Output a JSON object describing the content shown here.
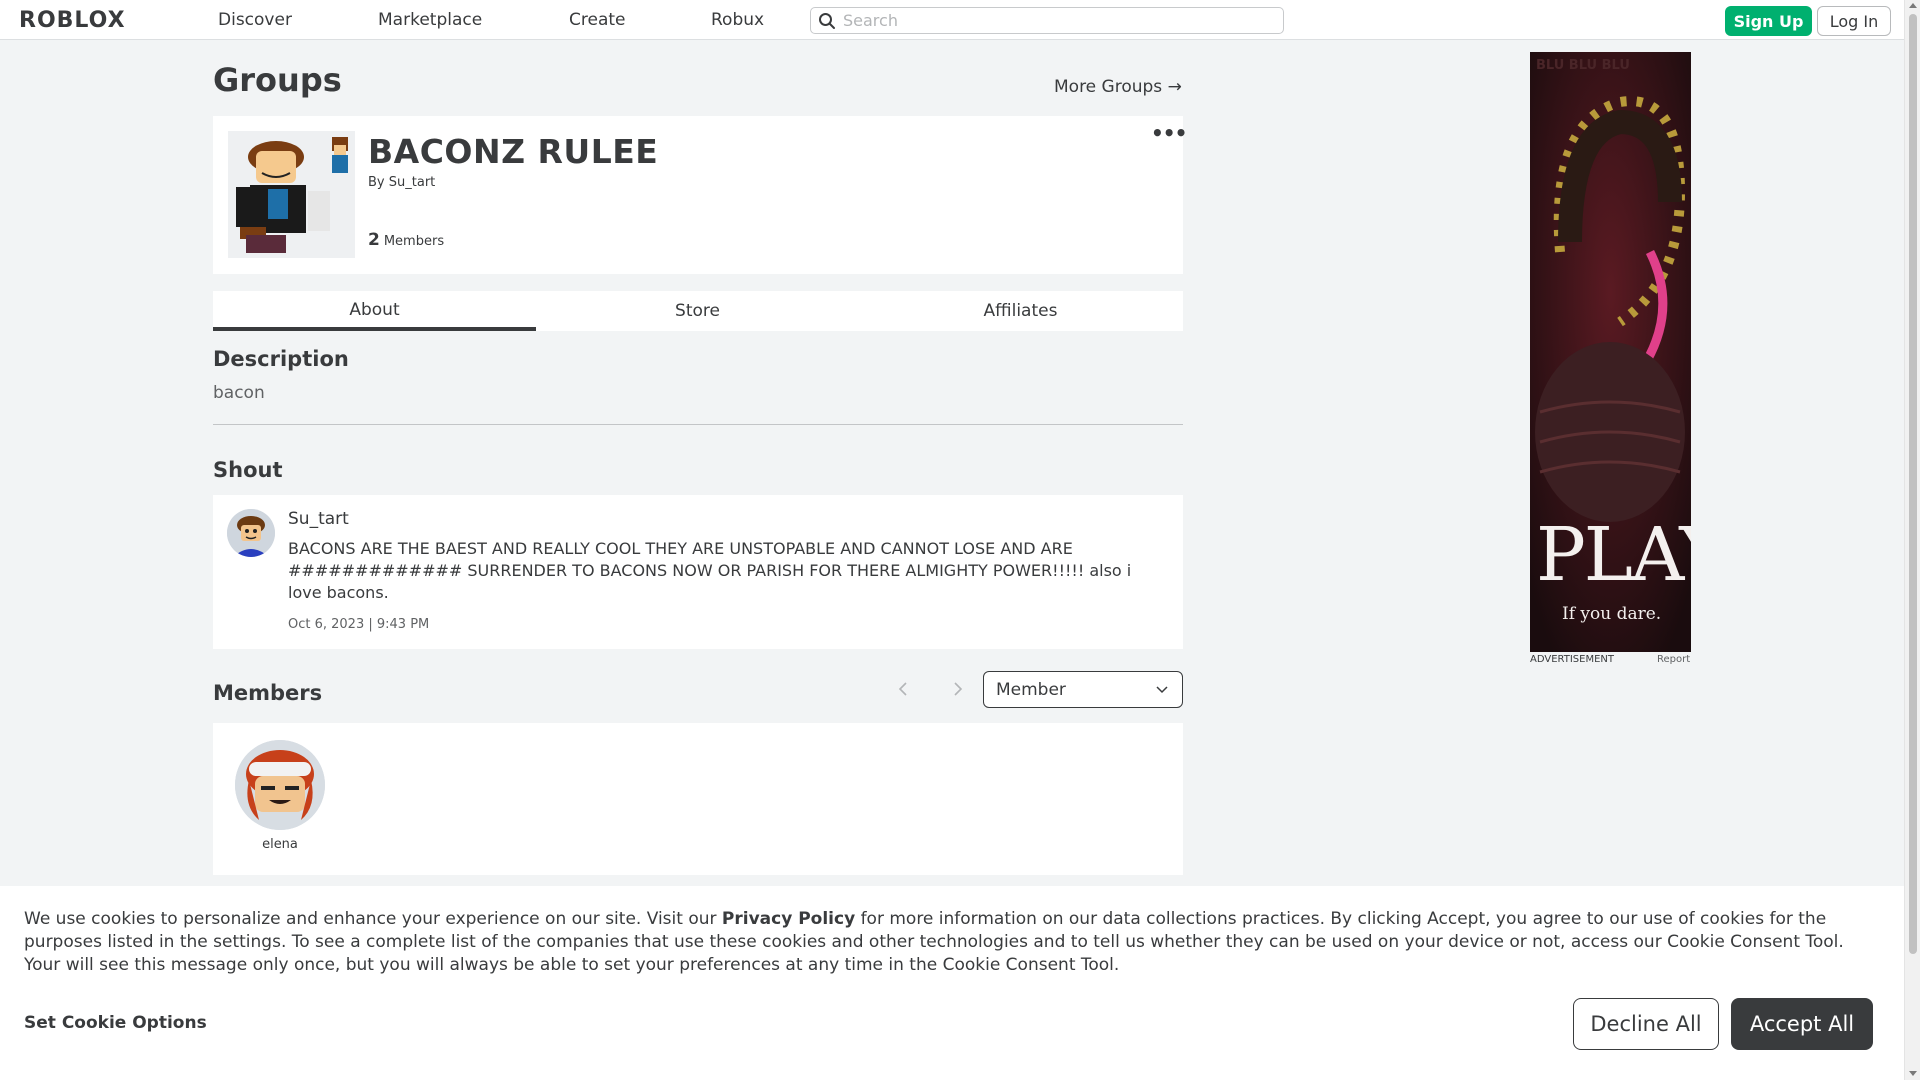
{
  "nav": {
    "logo": "ROBLOX",
    "links": [
      "Discover",
      "Marketplace",
      "Create",
      "Robux"
    ],
    "search_placeholder": "Search",
    "signup_label": "Sign Up",
    "login_label": "Log In"
  },
  "page": {
    "title": "Groups",
    "more_groups": "More Groups",
    "more_groups_arrow": "→"
  },
  "group": {
    "name": "BACONZ RULEE",
    "by_label": "By",
    "owner": "Su_tart",
    "member_count": "2",
    "members_label": "Members",
    "menu_icon": "•••"
  },
  "tabs": [
    "About",
    "Store",
    "Affiliates"
  ],
  "about": {
    "description_heading": "Description",
    "description": "bacon",
    "shout_heading": "Shout",
    "shout": {
      "user": "Su_tart",
      "body": "BACONS ARE THE BAEST AND REALLY COOL THEY ARE UNSTOPABLE AND CANNOT LOSE AND ARE ############# SURRENDER TO BACONS NOW OR PARISH FOR THERE ALMIGHTY POWER!!!!! also i love bacons.",
      "date": "Oct 6, 2023 | 9:43 PM"
    },
    "members_heading": "Members",
    "role_selected": "Member",
    "members": [
      {
        "name": "elena"
      }
    ]
  },
  "ad": {
    "label": "ADVERTISEMENT",
    "report": "Report",
    "headline": "PLAY",
    "tagline": "If you dare.",
    "watermark": "BLU BLU BLU"
  },
  "cookie": {
    "text_before": "We use cookies to personalize and enhance your experience on our site. Visit our ",
    "privacy_link": "Privacy Policy",
    "text_after": " for more information on our data collections practices. By clicking Accept, you agree to our use of cookies for the purposes listed in the settings. To see a complete list of the companies that use these cookies and other technologies and to tell us whether they can be used on your device or not, access our Cookie Consent Tool. Your will see this message only once, but you will always be able to set your preferences at any time in the Cookie Consent Tool.",
    "options_label": "Set Cookie Options",
    "decline_label": "Decline All",
    "accept_label": "Accept All"
  },
  "colors": {
    "signup_green": "#00b06f",
    "page_bg": "#f2f4f5",
    "text_dark": "#393b3d"
  }
}
